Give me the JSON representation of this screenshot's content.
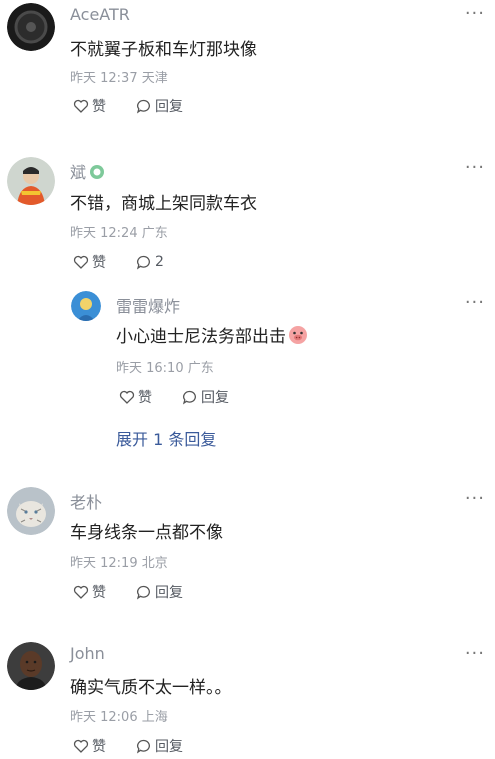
{
  "comments": [
    {
      "name": "AceATR",
      "text": "不就翼子板和车灯那块像",
      "meta": "昨天 12:37 天津",
      "like_label": "赞",
      "reply_label": "回复"
    },
    {
      "name": "斌",
      "text": "不错，商城上架同款车衣",
      "meta": "昨天 12:24 广东",
      "like_label": "赞",
      "reply_label": "2",
      "replies": [
        {
          "name": "雷雷爆炸",
          "text": "小心迪士尼法务部出击",
          "meta": "昨天 16:10 广东",
          "like_label": "赞",
          "reply_label": "回复"
        }
      ],
      "expand_label": "展开 1 条回复"
    },
    {
      "name": "老朴",
      "text": "车身线条一点都不像",
      "meta": "昨天 12:19 北京",
      "like_label": "赞",
      "reply_label": "回复"
    },
    {
      "name": "John",
      "text": "确实气质不太一样。。",
      "meta": "昨天 12:06 上海",
      "like_label": "赞",
      "reply_label": "回复"
    }
  ],
  "more_label": "···",
  "colors": {
    "name": "#8a8f99",
    "text": "#222222",
    "meta": "#9a9ea6",
    "link": "#3a5a9a"
  }
}
